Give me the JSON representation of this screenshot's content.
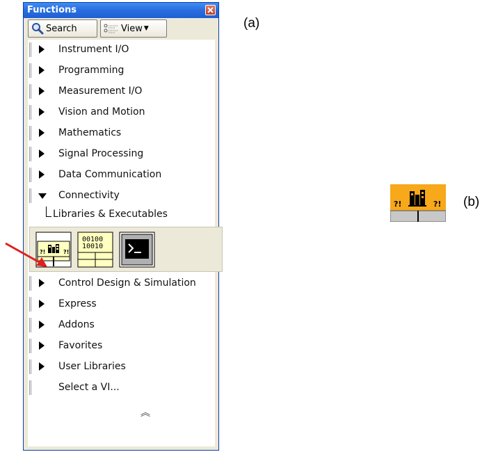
{
  "palette": {
    "title": "Functions",
    "search_label": "Search",
    "view_label": "View",
    "categories_top": [
      {
        "label": "Instrument I/O"
      },
      {
        "label": "Programming"
      },
      {
        "label": "Measurement I/O"
      },
      {
        "label": "Vision and Motion"
      },
      {
        "label": "Mathematics"
      },
      {
        "label": "Signal Processing"
      },
      {
        "label": "Data Communication"
      }
    ],
    "expanded": {
      "label": "Connectivity",
      "subcategory": "Libraries & Executables",
      "vi_icons": [
        "call-library-function-icon",
        "code-interface-node-icon",
        "system-exec-icon"
      ],
      "cin_text": "00100\n10010"
    },
    "categories_bottom": [
      {
        "label": "Control Design & Simulation"
      },
      {
        "label": "Express"
      },
      {
        "label": "Addons"
      },
      {
        "label": "Favorites"
      },
      {
        "label": "User Libraries"
      }
    ],
    "select_vi": "Select a VI...",
    "more_icon": "double-chevron-up-icon"
  },
  "annotations": {
    "label_a": "(a)",
    "label_b": "(b)",
    "pointer_color": "#e02020"
  },
  "colors": {
    "titlebar": "#2a6fe0",
    "clf_icon_orange": "#f7a81b",
    "cin_icon_yellow": "#ffffc0"
  }
}
